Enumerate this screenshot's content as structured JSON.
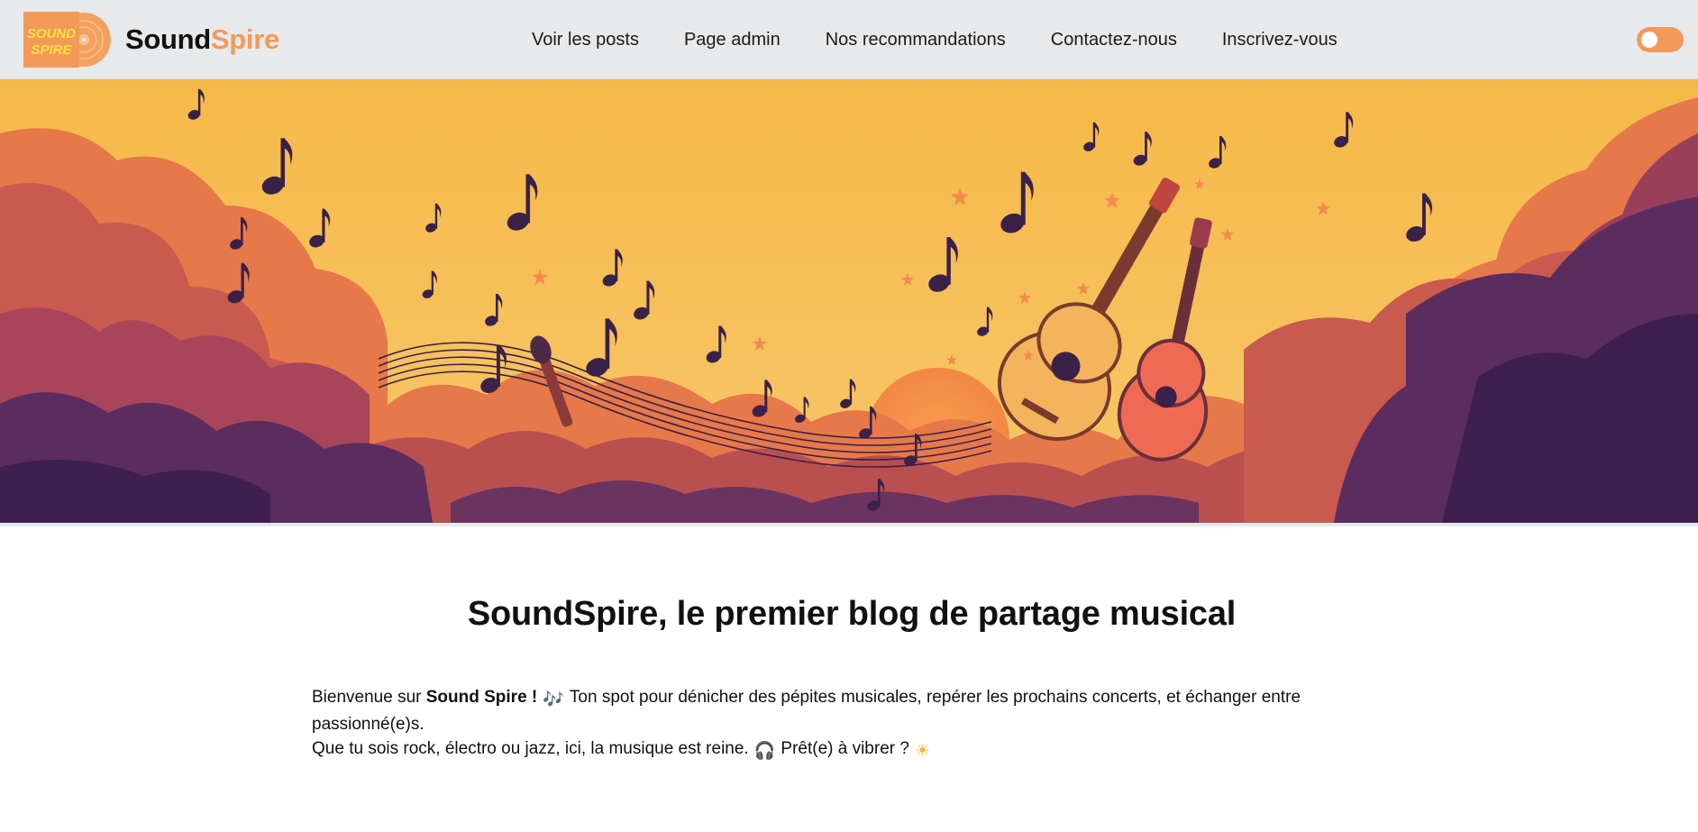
{
  "header": {
    "logo_text_line1": "SOUND",
    "logo_text_line2": "SPIRE",
    "brand_part1": "Sound",
    "brand_part2": "Spire",
    "nav": [
      {
        "label": "Voir les posts"
      },
      {
        "label": "Page admin"
      },
      {
        "label": "Nos recommandations"
      },
      {
        "label": "Contactez-nous"
      },
      {
        "label": "Inscrivez-vous"
      }
    ],
    "theme_toggle_icon": "toggle-switch-icon"
  },
  "hero": {
    "image_subject": "music-banner-illustration"
  },
  "main": {
    "title": "SoundSpire, le premier blog de partage musical",
    "intro": {
      "welcome_prefix": "Bienvenue sur",
      "site_name": "Sound Spire !",
      "emoji_notes": "🎶",
      "line1_rest": "Ton spot pour dénicher des pépites musicales, repérer les prochains concerts, et échanger entre passionné(e)s.",
      "line2_text": "Que tu sois rock, électro ou jazz, ici, la musique est reine.",
      "emoji_headphones": "🎧",
      "line2_question": "Prêt(e) à vibrer ?",
      "emoji_sun": "☀"
    }
  },
  "colors": {
    "accent": "#f39a5b",
    "header_bg": "#e8e9eb",
    "hero_sky": "#f7bd55",
    "hero_purple": "#4a2a5c"
  }
}
